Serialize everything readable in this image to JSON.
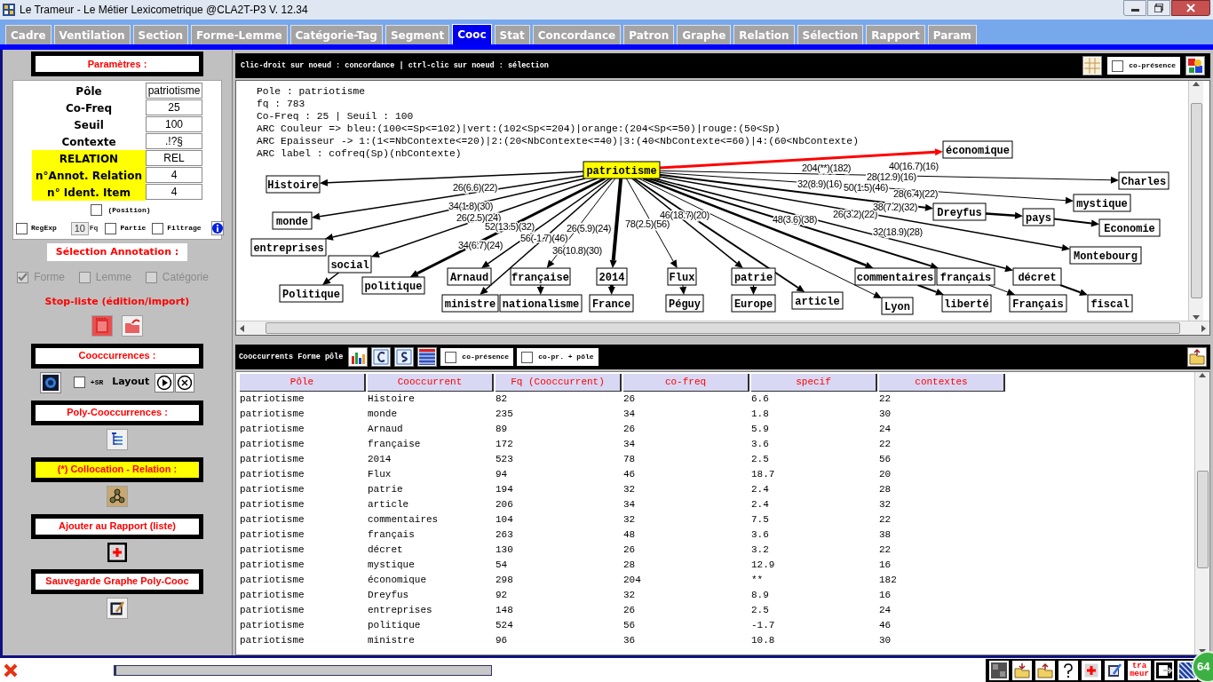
{
  "window": {
    "title": "Le Trameur - Le Métier Lexicometrique @CLA2T-P3 V. 12.34"
  },
  "tabs": [
    {
      "label": "Cadre",
      "selected": false
    },
    {
      "label": "Ventilation",
      "selected": false
    },
    {
      "label": "Section",
      "selected": false
    },
    {
      "label": "Forme-Lemme",
      "selected": false
    },
    {
      "label": "Catégorie-Tag",
      "selected": false
    },
    {
      "label": "Segment",
      "selected": false
    },
    {
      "label": "Cooc",
      "selected": true
    },
    {
      "label": "Stat",
      "selected": false
    },
    {
      "label": "Concordance",
      "selected": false
    },
    {
      "label": "Patron",
      "selected": false
    },
    {
      "label": "Graphe",
      "selected": false
    },
    {
      "label": "Relation",
      "selected": false
    },
    {
      "label": "Sélection",
      "selected": false
    },
    {
      "label": "Rapport",
      "selected": false
    },
    {
      "label": "Param",
      "selected": false
    }
  ],
  "parameters": {
    "heading": "Paramètres :",
    "fields": [
      {
        "label": "Pôle",
        "value": "patriotisme",
        "highlighted": false
      },
      {
        "label": "Co-Freq",
        "value": "25",
        "highlighted": false
      },
      {
        "label": "Seuil",
        "value": "100",
        "highlighted": false
      },
      {
        "label": "Contexte",
        "value": ".!?§",
        "highlighted": false
      },
      {
        "label": "RELATION",
        "value": "REL",
        "highlighted": true
      },
      {
        "label": "n°Annot. Relation",
        "value": "4",
        "highlighted": true
      },
      {
        "label": "n° Ident. Item",
        "value": "4",
        "highlighted": true
      }
    ],
    "position": {
      "label": "(Position)",
      "checked": false
    },
    "options": [
      {
        "kind": "checkbox",
        "label": "RegExp",
        "checked": false
      },
      {
        "kind": "number",
        "value": "10",
        "label": "Fq"
      },
      {
        "kind": "checkbox",
        "label": "Partie",
        "checked": false
      },
      {
        "kind": "checkbox",
        "label": "Filtrage",
        "checked": false
      }
    ]
  },
  "annotation": {
    "heading": "Sélection Annotation :",
    "choices": [
      {
        "label": "Forme",
        "checked": true,
        "disabled": true
      },
      {
        "label": "Lemme",
        "checked": false,
        "disabled": true
      },
      {
        "label": "Catégorie",
        "checked": false,
        "disabled": true
      }
    ]
  },
  "stoplist": {
    "heading": "Stop-liste (édition/import)"
  },
  "actions": [
    {
      "kind": "cooc",
      "heading": "Cooccurrences :",
      "highlighted": false,
      "sr": {
        "label": "+SR",
        "checked": false
      },
      "layout_label": "Layout"
    },
    {
      "kind": "poly",
      "heading": "Poly-Cooccurrences :",
      "highlighted": false
    },
    {
      "kind": "collocation",
      "heading": "(*) Collocation - Relation :",
      "highlighted": true
    },
    {
      "kind": "report",
      "heading": "Ajouter au Rapport (liste)",
      "highlighted": false
    },
    {
      "kind": "save",
      "heading": "Sauvegarde Graphe Poly-Cooc",
      "highlighted": false
    }
  ],
  "graph": {
    "hint": "Clic-droit sur noeud : concordance | ctrl-clic sur noeud : sélection",
    "copresence": {
      "label": "co-présence",
      "checked": false
    },
    "info": [
      "Pole : patriotisme",
      "fq : 783",
      "Co-Freq : 25 | Seuil : 100",
      "ARC Couleur => bleu:(100<=Sp<=102)|vert:(102<Sp<=204)|orange:(204<Sp<=50)|rouge:(50<Sp)",
      "ARC Epaisseur -> 1:(1<=NbContexte<=20)|2:(20<NbContexte<=40)|3:(40<NbContexte<=60)|4:(60<NbContexte)",
      "ARC label : cofreq(Sp)(nbContexte)"
    ],
    "pole": {
      "label": "patriotisme",
      "selected": true
    },
    "nodes": [
      {
        "label": "économique",
        "color": "#ff0000"
      },
      {
        "label": "Histoire",
        "color": "#000000"
      },
      {
        "label": "Charles",
        "color": "#000000"
      },
      {
        "label": "mystique",
        "color": "#000000"
      },
      {
        "label": "monde",
        "color": "#000000"
      },
      {
        "label": "Dreyfus",
        "color": "#000000"
      },
      {
        "label": "pays",
        "color": "#000000"
      },
      {
        "label": "Economie",
        "color": "#000000"
      },
      {
        "label": "entreprises",
        "color": "#000000"
      },
      {
        "label": "social",
        "color": "#000000"
      },
      {
        "label": "Montebourg",
        "color": "#000000"
      },
      {
        "label": "politique",
        "color": "#000000"
      },
      {
        "label": "Politique",
        "color": "#000000"
      },
      {
        "label": "Arnaud",
        "color": "#000000"
      },
      {
        "label": "française",
        "color": "#000000"
      },
      {
        "label": "2014",
        "color": "#000000"
      },
      {
        "label": "Flux",
        "color": "#000000"
      },
      {
        "label": "patrie",
        "color": "#000000"
      },
      {
        "label": "commentaires",
        "color": "#000000"
      },
      {
        "label": "français",
        "color": "#000000"
      },
      {
        "label": "décret",
        "color": "#000000"
      },
      {
        "label": "ministre",
        "color": "#000000"
      },
      {
        "label": "nationalisme",
        "color": "#000000"
      },
      {
        "label": "France",
        "color": "#000000"
      },
      {
        "label": "Péguy",
        "color": "#000000"
      },
      {
        "label": "Europe",
        "color": "#000000"
      },
      {
        "label": "article",
        "color": "#000000"
      },
      {
        "label": "Lyon",
        "color": "#000000"
      },
      {
        "label": "liberté",
        "color": "#000000"
      },
      {
        "label": "Français",
        "color": "#000000"
      },
      {
        "label": "fiscal",
        "color": "#000000"
      }
    ],
    "arc_labels": [
      "26(6.6)(22)",
      "34(1.8)(30)",
      "26(2.5)(24)",
      "52(13.5)(32)",
      "34(6.7)(24)",
      "56(-1.7)(46)",
      "26(5.9)(24)",
      "36(10.8)(30)",
      "78(2.5)(56)",
      "46(18.7)(20)",
      "48(3.6)(38)",
      "26(3.2)(22)",
      "32(18.9)(28)",
      "204(**)(182)",
      "40(16.7)(16)",
      "28(12.9)(16)",
      "32(8.9)(16)",
      "50(1.5)(46)",
      "28(6.4)(22)",
      "38(7.2)(32)"
    ]
  },
  "table": {
    "title": "Cooccurrents Forme pôle",
    "options": [
      {
        "label": "co-présence",
        "checked": false
      },
      {
        "label": "co-pr. + pôle",
        "checked": false
      }
    ],
    "columns": [
      "Pôle",
      "Cooccurrent",
      "Fq (Cooccurrent)",
      "co-freq",
      "specif",
      "contextes"
    ],
    "rows": [
      [
        "patriotisme",
        "Histoire",
        "82",
        "26",
        "6.6",
        "22"
      ],
      [
        "patriotisme",
        "monde",
        "235",
        "34",
        "1.8",
        "30"
      ],
      [
        "patriotisme",
        "Arnaud",
        "89",
        "26",
        "5.9",
        "24"
      ],
      [
        "patriotisme",
        "française",
        "172",
        "34",
        "3.6",
        "22"
      ],
      [
        "patriotisme",
        "2014",
        "523",
        "78",
        "2.5",
        "56"
      ],
      [
        "patriotisme",
        "Flux",
        "94",
        "46",
        "18.7",
        "20"
      ],
      [
        "patriotisme",
        "patrie",
        "194",
        "32",
        "2.4",
        "28"
      ],
      [
        "patriotisme",
        "article",
        "206",
        "34",
        "2.4",
        "32"
      ],
      [
        "patriotisme",
        "commentaires",
        "104",
        "32",
        "7.5",
        "22"
      ],
      [
        "patriotisme",
        "français",
        "263",
        "48",
        "3.6",
        "38"
      ],
      [
        "patriotisme",
        "décret",
        "130",
        "26",
        "3.2",
        "22"
      ],
      [
        "patriotisme",
        "mystique",
        "54",
        "28",
        "12.9",
        "16"
      ],
      [
        "patriotisme",
        "économique",
        "298",
        "204",
        "**",
        "182"
      ],
      [
        "patriotisme",
        "Dreyfus",
        "92",
        "32",
        "8.9",
        "16"
      ],
      [
        "patriotisme",
        "entreprises",
        "148",
        "26",
        "2.5",
        "24"
      ],
      [
        "patriotisme",
        "politique",
        "524",
        "56",
        "-1.7",
        "46"
      ],
      [
        "patriotisme",
        "ministre",
        "96",
        "36",
        "10.8",
        "30"
      ]
    ]
  },
  "status_bar": {
    "progress": {
      "level": 0
    },
    "logo": [
      "tra",
      "meur"
    ],
    "badge": "64"
  }
}
